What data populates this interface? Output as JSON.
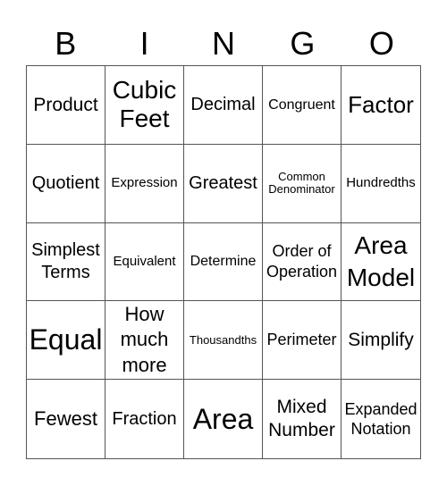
{
  "header": [
    "B",
    "I",
    "N",
    "G",
    "O"
  ],
  "cells": [
    "Product",
    "Cubic Feet",
    "Decimal",
    "Congruent",
    "Factor",
    "Quotient",
    "Expression",
    "Greatest",
    "Common Denominator",
    "Hundredths",
    "Simplest Terms",
    "Equivalent",
    "Determine",
    "Order of Operation",
    "Area Model",
    "Equal",
    "How much more",
    "Thousandths",
    "Perimeter",
    "Simplify",
    "Fewest",
    "Fraction",
    "Area",
    "Mixed Number",
    "Expanded Notation"
  ]
}
